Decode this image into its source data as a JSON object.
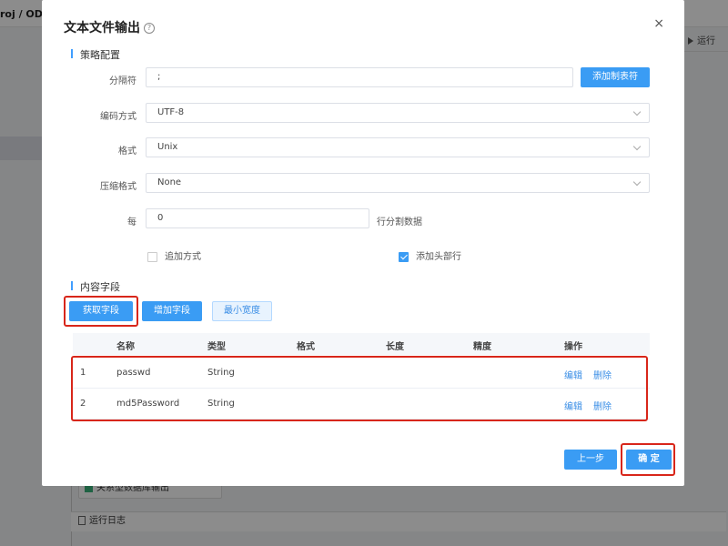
{
  "background": {
    "breadcrumb": "roj / ODS",
    "run_label": "运行",
    "node_label": "关系型数据库输出",
    "log_label": "运行日志"
  },
  "dialog": {
    "title": "文本文件输出",
    "close_glyph": "×",
    "help_glyph": "?",
    "strategy": {
      "section_title": "策略配置",
      "delimiter_label": "分隔符",
      "delimiter_value": ";",
      "add_tab_button": "添加制表符",
      "encoding_label": "编码方式",
      "encoding_value": "UTF-8",
      "format_label": "格式",
      "format_value": "Unix",
      "compression_label": "压缩格式",
      "compression_value": "None",
      "per_label": "每",
      "per_value": "0",
      "per_suffix": "行分割数据",
      "append_label": "追加方式",
      "append_checked": false,
      "header_label": "添加头部行",
      "header_checked": true
    },
    "fields": {
      "section_title": "内容字段",
      "get_fields_button": "获取字段",
      "add_field_button": "增加字段",
      "min_width_button": "最小宽度",
      "columns": [
        "名称",
        "类型",
        "格式",
        "长度",
        "精度",
        "操作"
      ],
      "rows": [
        {
          "index": "1",
          "name": "passwd",
          "type": "String",
          "edit": "编辑",
          "delete": "删除"
        },
        {
          "index": "2",
          "name": "md5Password",
          "type": "String",
          "edit": "编辑",
          "delete": "删除"
        }
      ]
    },
    "footer": {
      "prev_button": "上一步",
      "confirm_button": "确 定"
    }
  },
  "colors": {
    "primary": "#3a9cf4",
    "highlight": "#d8261a"
  }
}
